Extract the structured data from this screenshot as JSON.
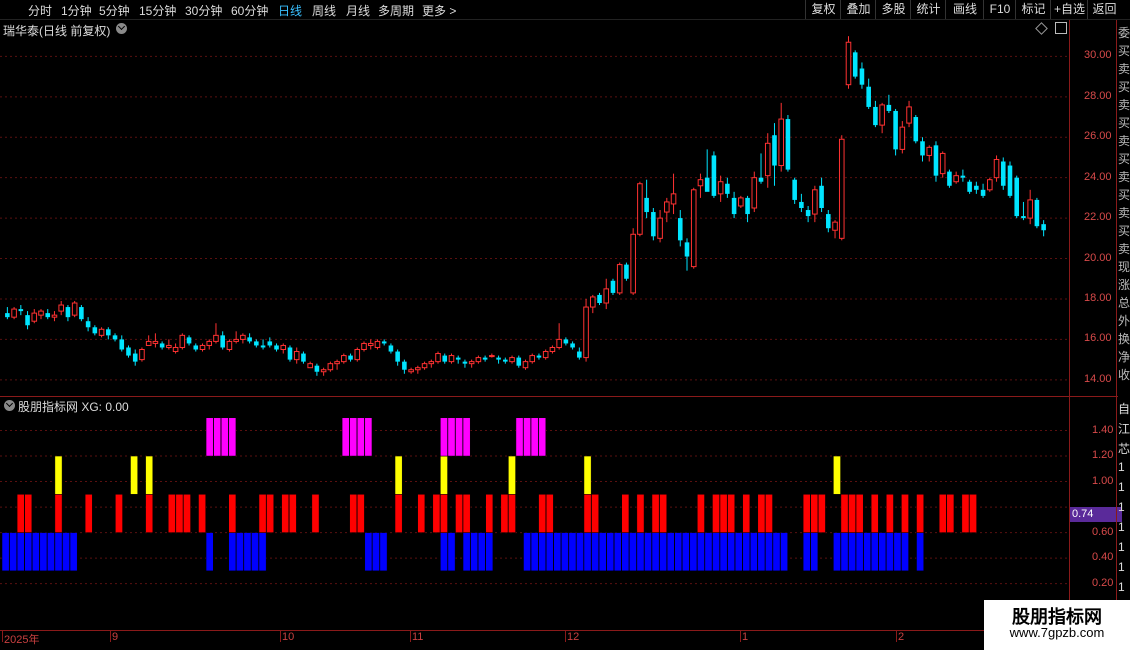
{
  "toolbar": {
    "tabs": [
      "分时",
      "1分钟",
      "5分钟",
      "15分钟",
      "30分钟",
      "60分钟",
      "日线",
      "周线",
      "月线",
      "多周期",
      "更多 >"
    ],
    "active_tab": "日线",
    "right_buttons": [
      "复权",
      "叠加",
      "多股",
      "统计",
      "画线",
      "F10",
      "标记",
      "+自选",
      "返回"
    ]
  },
  "main_chart": {
    "title": "瑞华泰(日线 前复权)",
    "y_labels": [
      "30.00",
      "28.00",
      "26.00",
      "24.00",
      "22.00",
      "20.00",
      "18.00",
      "16.00",
      "14.00"
    ]
  },
  "indicator": {
    "title": "股朋指标网  XG: 0.00",
    "y_labels": [
      "1.40",
      "1.20",
      "1.00",
      "0.60",
      "0.40",
      "0.20"
    ],
    "current_value": "0.74"
  },
  "date_axis": {
    "labels": [
      "2025年",
      "9",
      "10",
      "11",
      "12",
      "1",
      "2"
    ]
  },
  "side_panel": {
    "chars": [
      "委",
      "买",
      "卖",
      "买",
      "卖",
      "买",
      "卖",
      "买",
      "卖",
      "买",
      "卖",
      "买",
      "卖",
      "现",
      "涨",
      "总",
      "外",
      "换",
      "净",
      "收"
    ],
    "lower_chars": [
      "自",
      "江",
      "芯",
      "1",
      "1",
      "1",
      "1",
      "1",
      "1",
      "1"
    ]
  },
  "watermark": {
    "name": "股朋指标网",
    "url": "www.7gpzb.com"
  },
  "colors": {
    "up": "#ff3232",
    "down": "#00e5ff",
    "bar_red": "#ff0000",
    "bar_blue": "#0000ff",
    "bar_yellow": "#ffff00",
    "bar_magenta": "#ff00ff",
    "grid": "#5a1010"
  },
  "chart_data": {
    "type": "candlestick",
    "y_range": [
      13.2,
      31.8
    ],
    "candles": [
      [
        17.3,
        17.6,
        17.0,
        17.1
      ],
      [
        17.1,
        17.6,
        17.0,
        17.5
      ],
      [
        17.5,
        17.7,
        17.2,
        17.4
      ],
      [
        17.2,
        17.4,
        16.5,
        16.7
      ],
      [
        16.9,
        17.5,
        16.8,
        17.3
      ],
      [
        17.2,
        17.5,
        17.0,
        17.4
      ],
      [
        17.3,
        17.5,
        17.0,
        17.1
      ],
      [
        17.1,
        17.4,
        16.9,
        17.2
      ],
      [
        17.4,
        17.9,
        17.2,
        17.7
      ],
      [
        17.6,
        17.7,
        16.9,
        17.1
      ],
      [
        17.2,
        17.9,
        17.1,
        17.8
      ],
      [
        17.6,
        17.7,
        16.9,
        17.0
      ],
      [
        16.9,
        17.1,
        16.4,
        16.6
      ],
      [
        16.6,
        16.7,
        16.2,
        16.3
      ],
      [
        16.2,
        16.6,
        16.1,
        16.5
      ],
      [
        16.5,
        16.6,
        16.0,
        16.2
      ],
      [
        16.2,
        16.3,
        15.9,
        16.0
      ],
      [
        16.0,
        16.2,
        15.4,
        15.5
      ],
      [
        15.6,
        15.7,
        15.1,
        15.2
      ],
      [
        15.3,
        15.5,
        14.7,
        14.9
      ],
      [
        15.0,
        15.6,
        14.9,
        15.5
      ],
      [
        15.7,
        16.2,
        15.7,
        15.9
      ],
      [
        15.8,
        16.3,
        15.6,
        15.9
      ],
      [
        15.8,
        15.9,
        15.5,
        15.6
      ],
      [
        15.6,
        16.0,
        15.5,
        15.7
      ],
      [
        15.4,
        15.8,
        15.3,
        15.6
      ],
      [
        15.6,
        16.3,
        15.5,
        16.2
      ],
      [
        16.1,
        16.2,
        15.7,
        15.8
      ],
      [
        15.7,
        15.8,
        15.4,
        15.5
      ],
      [
        15.5,
        15.8,
        15.4,
        15.7
      ],
      [
        15.7,
        16.0,
        15.5,
        15.9
      ],
      [
        15.9,
        16.8,
        15.8,
        16.2
      ],
      [
        16.2,
        16.4,
        15.5,
        15.6
      ],
      [
        15.5,
        16.0,
        15.4,
        15.9
      ],
      [
        15.9,
        16.4,
        15.8,
        16.0
      ],
      [
        16.0,
        16.3,
        15.8,
        16.2
      ],
      [
        16.1,
        16.3,
        15.8,
        15.9
      ],
      [
        15.9,
        16.0,
        15.6,
        15.7
      ],
      [
        15.7,
        16.0,
        15.5,
        15.6
      ],
      [
        15.9,
        16.1,
        15.6,
        15.7
      ],
      [
        15.7,
        15.8,
        15.4,
        15.5
      ],
      [
        15.5,
        15.8,
        15.3,
        15.7
      ],
      [
        15.6,
        15.7,
        14.9,
        15.0
      ],
      [
        15.0,
        15.6,
        14.8,
        15.4
      ],
      [
        15.3,
        15.4,
        14.8,
        14.9
      ],
      [
        14.6,
        14.9,
        14.6,
        14.8
      ],
      [
        14.7,
        14.8,
        14.2,
        14.4
      ],
      [
        14.4,
        14.6,
        14.2,
        14.5
      ],
      [
        14.5,
        14.9,
        14.4,
        14.8
      ],
      [
        14.8,
        15.0,
        14.5,
        14.9
      ],
      [
        14.9,
        15.3,
        14.8,
        15.2
      ],
      [
        15.2,
        15.3,
        14.9,
        15.0
      ],
      [
        15.0,
        15.6,
        14.9,
        15.5
      ],
      [
        15.5,
        15.9,
        15.4,
        15.8
      ],
      [
        15.7,
        16.0,
        15.5,
        15.8
      ],
      [
        15.6,
        16.0,
        15.5,
        15.9
      ],
      [
        15.9,
        16.0,
        15.7,
        15.8
      ],
      [
        15.7,
        15.8,
        15.3,
        15.4
      ],
      [
        15.4,
        15.5,
        14.7,
        14.9
      ],
      [
        14.9,
        15.0,
        14.3,
        14.5
      ],
      [
        14.4,
        14.6,
        14.3,
        14.5
      ],
      [
        14.5,
        14.7,
        14.3,
        14.6
      ],
      [
        14.6,
        14.9,
        14.5,
        14.8
      ],
      [
        14.8,
        15.0,
        14.6,
        14.9
      ],
      [
        14.9,
        15.4,
        14.8,
        15.3
      ],
      [
        15.2,
        15.3,
        14.8,
        14.9
      ],
      [
        14.9,
        15.3,
        14.8,
        15.2
      ],
      [
        15.1,
        15.2,
        14.8,
        15.0
      ],
      [
        14.9,
        15.0,
        14.6,
        14.8
      ],
      [
        14.8,
        15.0,
        14.6,
        14.9
      ],
      [
        14.9,
        15.2,
        14.8,
        15.1
      ],
      [
        15.1,
        15.2,
        14.9,
        15.0
      ],
      [
        15.2,
        15.3,
        15.1,
        15.2
      ],
      [
        15.1,
        15.2,
        14.8,
        15.0
      ],
      [
        15.0,
        15.1,
        14.8,
        14.9
      ],
      [
        14.9,
        15.2,
        14.8,
        15.1
      ],
      [
        15.1,
        15.2,
        14.6,
        14.7
      ],
      [
        14.6,
        15.0,
        14.5,
        14.9
      ],
      [
        14.9,
        15.3,
        14.8,
        15.2
      ],
      [
        15.2,
        15.3,
        15.0,
        15.1
      ],
      [
        15.1,
        15.5,
        15.0,
        15.4
      ],
      [
        15.4,
        15.7,
        15.3,
        15.6
      ],
      [
        15.6,
        16.8,
        15.5,
        16.0
      ],
      [
        16.0,
        16.1,
        15.7,
        15.8
      ],
      [
        15.8,
        15.9,
        15.5,
        15.6
      ],
      [
        15.4,
        15.6,
        15.0,
        15.1
      ],
      [
        15.1,
        18.0,
        14.9,
        17.6
      ],
      [
        17.6,
        18.2,
        17.3,
        18.1
      ],
      [
        18.2,
        18.3,
        17.7,
        17.8
      ],
      [
        17.8,
        19.0,
        17.5,
        18.5
      ],
      [
        18.9,
        19.0,
        18.2,
        18.3
      ],
      [
        18.3,
        19.8,
        18.2,
        19.7
      ],
      [
        19.7,
        19.8,
        18.9,
        19.0
      ],
      [
        18.3,
        21.5,
        18.2,
        21.2
      ],
      [
        21.2,
        23.8,
        21.1,
        23.7
      ],
      [
        23.0,
        23.9,
        22.0,
        22.3
      ],
      [
        22.3,
        22.5,
        20.9,
        21.1
      ],
      [
        21.0,
        22.4,
        20.8,
        22.0
      ],
      [
        22.3,
        23.0,
        21.8,
        22.8
      ],
      [
        22.7,
        24.2,
        22.2,
        23.2
      ],
      [
        22.0,
        22.4,
        20.6,
        20.9
      ],
      [
        20.8,
        21.0,
        19.4,
        20.1
      ],
      [
        19.6,
        23.5,
        19.5,
        23.4
      ],
      [
        23.6,
        24.2,
        23.0,
        23.9
      ],
      [
        24.0,
        25.4,
        23.8,
        23.3
      ],
      [
        25.1,
        25.3,
        23.0,
        23.1
      ],
      [
        23.2,
        24.1,
        22.8,
        23.8
      ],
      [
        23.7,
        24.0,
        23.0,
        23.2
      ],
      [
        23.0,
        23.3,
        22.0,
        22.2
      ],
      [
        22.6,
        23.1,
        22.5,
        23.0
      ],
      [
        23.0,
        23.1,
        21.8,
        22.2
      ],
      [
        22.5,
        24.3,
        22.3,
        24.0
      ],
      [
        24.0,
        25.2,
        23.7,
        23.8
      ],
      [
        24.1,
        26.2,
        23.5,
        25.7
      ],
      [
        26.1,
        26.7,
        23.6,
        24.6
      ],
      [
        24.6,
        27.7,
        24.3,
        26.9
      ],
      [
        26.9,
        27.1,
        24.3,
        24.4
      ],
      [
        23.9,
        24.0,
        22.7,
        22.9
      ],
      [
        22.8,
        23.2,
        22.3,
        22.5
      ],
      [
        22.4,
        22.6,
        21.8,
        22.1
      ],
      [
        22.2,
        23.6,
        21.8,
        23.4
      ],
      [
        23.6,
        24.0,
        22.3,
        22.5
      ],
      [
        22.2,
        22.4,
        21.3,
        21.5
      ],
      [
        21.4,
        21.9,
        21.0,
        21.8
      ],
      [
        21.0,
        26.1,
        20.9,
        25.9
      ],
      [
        28.6,
        31.0,
        28.4,
        30.7
      ],
      [
        30.2,
        30.3,
        28.9,
        29.0
      ],
      [
        29.4,
        29.7,
        28.4,
        28.6
      ],
      [
        28.5,
        28.9,
        27.4,
        27.5
      ],
      [
        27.5,
        27.8,
        26.5,
        26.6
      ],
      [
        26.6,
        27.7,
        26.2,
        27.6
      ],
      [
        27.6,
        28.1,
        27.2,
        27.3
      ],
      [
        27.3,
        27.4,
        25.1,
        25.4
      ],
      [
        25.4,
        26.8,
        25.2,
        26.5
      ],
      [
        26.7,
        27.8,
        26.5,
        27.5
      ],
      [
        27.0,
        27.1,
        25.7,
        25.8
      ],
      [
        25.8,
        26.0,
        24.8,
        25.1
      ],
      [
        25.1,
        25.6,
        24.8,
        25.5
      ],
      [
        25.6,
        25.8,
        23.8,
        24.1
      ],
      [
        24.2,
        25.3,
        24.0,
        25.2
      ],
      [
        24.3,
        24.4,
        23.5,
        23.6
      ],
      [
        23.8,
        24.3,
        23.7,
        24.1
      ],
      [
        24.1,
        24.4,
        23.8,
        24.0
      ],
      [
        23.8,
        23.9,
        23.2,
        23.3
      ],
      [
        23.6,
        23.8,
        23.2,
        23.4
      ],
      [
        23.4,
        23.7,
        23.0,
        23.1
      ],
      [
        23.4,
        24.0,
        23.3,
        23.9
      ],
      [
        24.0,
        25.1,
        23.8,
        24.9
      ],
      [
        24.8,
        25.0,
        23.4,
        23.6
      ],
      [
        24.6,
        24.8,
        23.0,
        23.1
      ],
      [
        24.0,
        24.1,
        22.0,
        22.1
      ],
      [
        22.1,
        22.8,
        21.9,
        22.0
      ],
      [
        22.0,
        23.4,
        21.7,
        22.9
      ],
      [
        22.9,
        23.0,
        21.5,
        21.6
      ],
      [
        21.7,
        21.9,
        21.1,
        21.4
      ]
    ],
    "indicator_bars": [
      {
        "x": [
          2,
          4,
          6,
          7,
          9,
          11,
          12,
          13,
          14,
          15,
          17,
          19,
          24,
          27,
          33,
          34,
          36,
          42,
          51,
          52,
          55,
          59,
          62,
          64,
          65,
          68,
          69,
          71,
          73,
          76,
          78,
          79,
          80,
          81,
          82,
          84,
          86,
          87,
          89,
          91,
          93,
          94,
          96,
          98,
          99,
          100,
          101,
          102,
          104,
          106,
          107,
          108,
          109,
          111,
          113,
          115,
          116,
          117,
          118,
          119,
          121,
          123,
          124,
          125,
          126,
          127,
          128,
          129,
          130,
          131,
          132,
          134,
          135,
          137
        ],
        "name": "red"
      }
    ],
    "signals": {
      "red_indices": [
        2,
        3,
        7,
        11,
        15,
        19,
        22,
        23,
        24,
        26,
        30,
        34,
        35,
        37,
        38,
        41,
        46,
        47,
        52,
        55,
        57,
        58,
        60,
        61,
        64,
        66,
        67,
        71,
        72,
        77,
        78,
        82,
        84,
        86,
        87,
        92,
        94,
        95,
        96,
        98,
        100,
        101,
        106,
        107,
        108,
        111,
        112,
        113,
        115,
        117,
        119,
        121,
        124,
        125,
        127,
        128
      ],
      "yellow_indices": [
        7,
        17,
        19,
        52,
        58,
        67,
        77,
        110
      ],
      "magenta_indices": [
        27,
        28,
        29,
        30,
        45,
        46,
        47,
        48,
        58,
        59,
        60,
        61,
        68,
        69,
        70,
        71
      ],
      "blue_indices": [
        0,
        1,
        2,
        3,
        4,
        5,
        6,
        7,
        8,
        9,
        27,
        30,
        31,
        32,
        33,
        34,
        48,
        49,
        50,
        58,
        59,
        61,
        62,
        63,
        64,
        69,
        70,
        71,
        72,
        73,
        74,
        75,
        76,
        77,
        78,
        79,
        80,
        81,
        82,
        83,
        84,
        85,
        86,
        87,
        88,
        89,
        90,
        91,
        92,
        93,
        94,
        95,
        96,
        97,
        98,
        99,
        100,
        101,
        102,
        103,
        106,
        107,
        110,
        111,
        112,
        113,
        114,
        115,
        116,
        117,
        118,
        119,
        121
      ]
    }
  }
}
